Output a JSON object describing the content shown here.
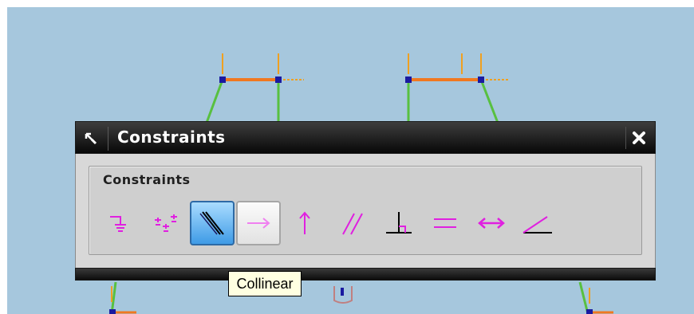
{
  "window": {
    "title": "Constraints"
  },
  "group": {
    "label": "Constraints"
  },
  "tools": [
    {
      "name": "coincident",
      "icon": "coincident-icon"
    },
    {
      "name": "point-on-curve",
      "icon": "point-on-curve-icon"
    },
    {
      "name": "collinear",
      "icon": "collinear-icon",
      "state": "selected"
    },
    {
      "name": "horizontal",
      "icon": "horizontal-arrow-icon",
      "state": "hovered"
    },
    {
      "name": "vertical",
      "icon": "vertical-arrow-icon"
    },
    {
      "name": "parallel",
      "icon": "parallel-icon"
    },
    {
      "name": "perpendicular",
      "icon": "perpendicular-icon"
    },
    {
      "name": "equal-length",
      "icon": "equal-icon"
    },
    {
      "name": "constant-length",
      "icon": "constant-length-icon"
    },
    {
      "name": "constant-angle",
      "icon": "angle-icon"
    }
  ],
  "tooltip": {
    "text": "Collinear"
  },
  "colors": {
    "viewport": "#a6c7dd",
    "constraint_icon": "#e020e0",
    "sketch_orange": "#f07820",
    "sketch_green": "#58c040",
    "sketch_blue": "#1a1aa0",
    "selected_tool": "#3f9be6"
  }
}
